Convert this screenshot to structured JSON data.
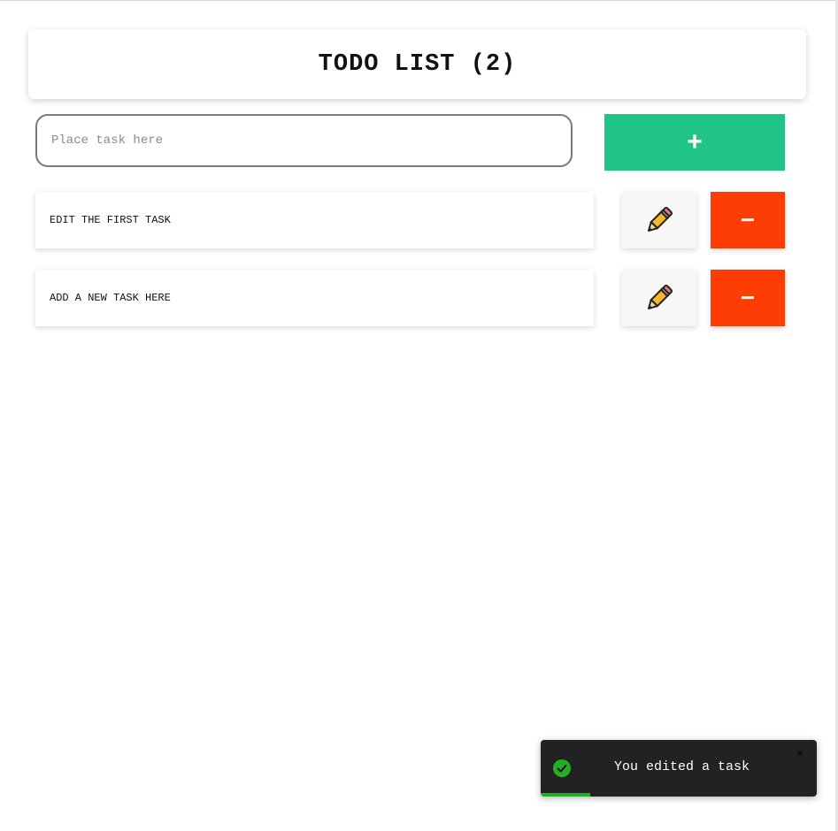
{
  "header": {
    "title": "TODO LIST (2)"
  },
  "input": {
    "placeholder": "Place task here",
    "value": ""
  },
  "add_button": {
    "label": "+",
    "color": "#20c388"
  },
  "tasks": [
    {
      "text": "EDIT THE FIRST TASK",
      "delete_label": "−"
    },
    {
      "text": "ADD A NEW TASK HERE",
      "delete_label": "−"
    }
  ],
  "edit_icon": "pencil-icon",
  "delete_color": "#fd3d04",
  "toast": {
    "message": "You edited a task",
    "icon": "check-circle-icon",
    "close_icon": "close-icon",
    "close_label": "×",
    "progress": 0.18,
    "background": "#222222",
    "accent": "#20b020"
  }
}
